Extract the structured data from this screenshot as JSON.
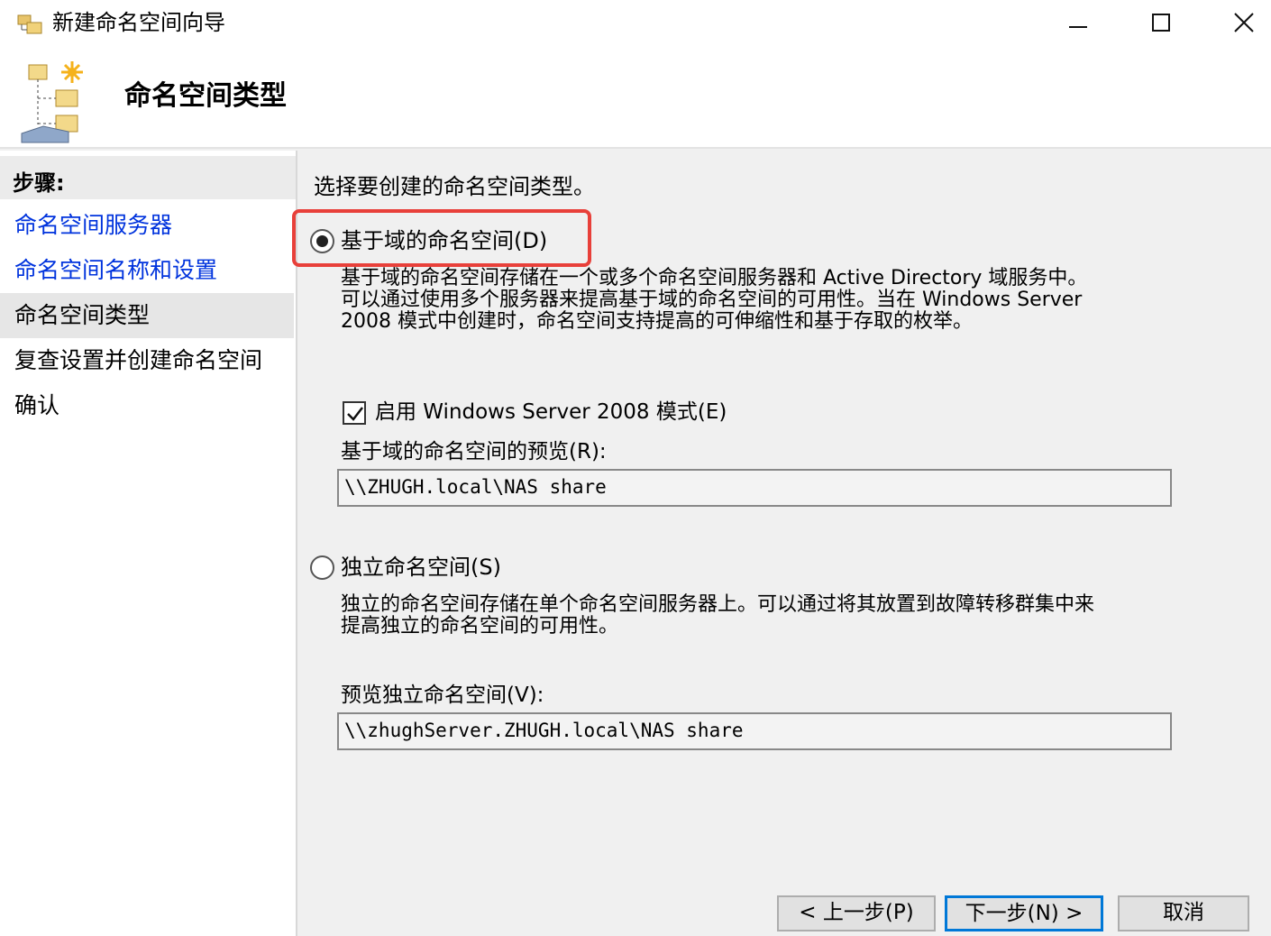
{
  "window": {
    "title": "新建命名空间向导",
    "icon": "folder-tree-icon"
  },
  "header": {
    "title": "命名空间类型",
    "icon": "namespace-wizard-icon"
  },
  "sidebar": {
    "heading": "步骤:",
    "items": [
      {
        "label": "命名空间服务器",
        "state": "link"
      },
      {
        "label": "命名空间名称和设置",
        "state": "link"
      },
      {
        "label": "命名空间类型",
        "state": "current"
      },
      {
        "label": "复查设置并创建命名空间",
        "state": "upcoming"
      },
      {
        "label": "确认",
        "state": "upcoming"
      }
    ]
  },
  "main": {
    "prompt": "选择要创建的命名空间类型。",
    "domain_option": {
      "label": "基于域的命名空间(D)",
      "selected": true,
      "description_lines": [
        "基于域的命名空间存储在一个或多个命名空间服务器和 Active Directory 域服务中。",
        "可以通过使用多个服务器来提高基于域的命名空间的可用性。当在 Windows Server",
        "2008 模式中创建时，命名空间支持提高的可伸缩性和基于存取的枚举。"
      ],
      "ws2008_checkbox": {
        "label": "启用 Windows Server 2008 模式(E)",
        "checked": true
      },
      "preview_label": "基于域的命名空间的预览(R):",
      "preview_value": "\\\\ZHUGH.local\\NAS share"
    },
    "standalone_option": {
      "label": "独立命名空间(S)",
      "selected": false,
      "description_lines": [
        "独立的命名空间存储在单个命名空间服务器上。可以通过将其放置到故障转移群集中来",
        "提高独立的命名空间的可用性。"
      ],
      "preview_label": "预览独立命名空间(V):",
      "preview_value": "\\\\zhughServer.ZHUGH.local\\NAS share"
    }
  },
  "footer": {
    "back_label": "< 上一步(P)",
    "next_label": "下一步(N) >",
    "cancel_label": "取消"
  },
  "colors": {
    "link": "#0033dd",
    "highlight_box": "#e8403a",
    "default_button_border": "#0078d7"
  }
}
